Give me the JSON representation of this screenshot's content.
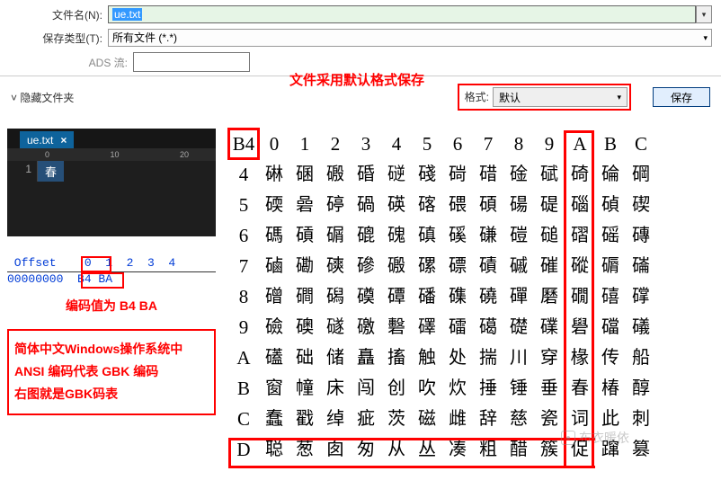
{
  "dialog": {
    "filename_label": "文件名(N):",
    "filename_value": "ue.txt",
    "filetype_label": "保存类型(T):",
    "filetype_value": "所有文件 (*.*)",
    "ads_label": "ADS 流:",
    "hide_folders": "隐藏文件夹",
    "format_label": "格式:",
    "format_value": "默认",
    "save_btn": "保存"
  },
  "annot": {
    "default_format": "文件采用默认格式保存",
    "code_value": "编码值为 B4 BA",
    "gbk_note_line1": "简体中文Windows操作系统中",
    "gbk_note_line2": "ANSI 编码代表 GBK 编码",
    "gbk_note_line3": "右图就是GBK码表"
  },
  "editor": {
    "tab_name": "ue.txt",
    "tab_close": "×",
    "ruler": [
      "0",
      "10",
      "20"
    ],
    "line_no": "1",
    "line_text": "春"
  },
  "hex": {
    "header": " Offset    0  1  2  3  4",
    "row": "00000000  B4 BA"
  },
  "watermark": {
    "text": "布衣暖依"
  },
  "chart_data": {
    "type": "table",
    "title": "GBK code page B4",
    "lead_byte_hex": "B4",
    "columns_hex": [
      "0",
      "1",
      "2",
      "3",
      "4",
      "5",
      "6",
      "7",
      "8",
      "9",
      "A",
      "B",
      "C"
    ],
    "rows": [
      {
        "second_nibble": "4",
        "chars": [
          "碄",
          "碅",
          "磤",
          "碈",
          "磀",
          "碊",
          "碋",
          "碏",
          "碒",
          "碔",
          "碕",
          "碖",
          "碙"
        ]
      },
      {
        "second_nibble": "5",
        "chars": [
          "碝",
          "碞",
          "碠",
          "碢",
          "碤",
          "碦",
          "碨",
          "碩",
          "碭",
          "碮",
          "碯",
          "碵",
          "碶"
        ]
      },
      {
        "second_nibble": "6",
        "chars": [
          "碼",
          "碽",
          "碿",
          "磇",
          "磈",
          "磌",
          "磎",
          "磏",
          "磑",
          "磓",
          "磖",
          "磘",
          "磚"
        ]
      },
      {
        "second_nibble": "7",
        "chars": [
          "磠",
          "磡",
          "磢",
          "磣",
          "磤",
          "磥",
          "磦",
          "磧",
          "磩",
          "磪",
          "磫",
          "磭",
          "磮"
        ]
      },
      {
        "second_nibble": "8",
        "chars": [
          "磳",
          "磵",
          "磶",
          "磸",
          "磹",
          "磻",
          "磼",
          "磽",
          "磾",
          "磿",
          "礀",
          "礂",
          "礃"
        ]
      },
      {
        "second_nibble": "9",
        "chars": [
          "礆",
          "礇",
          "礈",
          "礉",
          "礊",
          "礋",
          "礌",
          "礍",
          "礎",
          "礏",
          "礐",
          "礑",
          "礒"
        ]
      },
      {
        "second_nibble": "A",
        "chars": [
          "礚",
          "础",
          "储",
          "矗",
          "搐",
          "触",
          "处",
          "揣",
          "川",
          "穿",
          "椽",
          "传",
          "船"
        ]
      },
      {
        "second_nibble": "B",
        "chars": [
          "窗",
          "幢",
          "床",
          "闯",
          "创",
          "吹",
          "炊",
          "捶",
          "锤",
          "垂",
          "春",
          "椿",
          "醇"
        ]
      },
      {
        "second_nibble": "C",
        "chars": [
          "蠢",
          "戳",
          "绰",
          "疵",
          "茨",
          "磁",
          "雌",
          "辞",
          "慈",
          "瓷",
          "词",
          "此",
          "刺"
        ]
      },
      {
        "second_nibble": "D",
        "chars": [
          "聪",
          "葱",
          "囱",
          "匆",
          "从",
          "丛",
          "凑",
          "粗",
          "醋",
          "簇",
          "促",
          "蹿",
          "篡"
        ]
      }
    ],
    "highlight": {
      "row_nibble": "B",
      "column_hex": "A",
      "char": "春",
      "code_hex": "B4BA"
    }
  }
}
